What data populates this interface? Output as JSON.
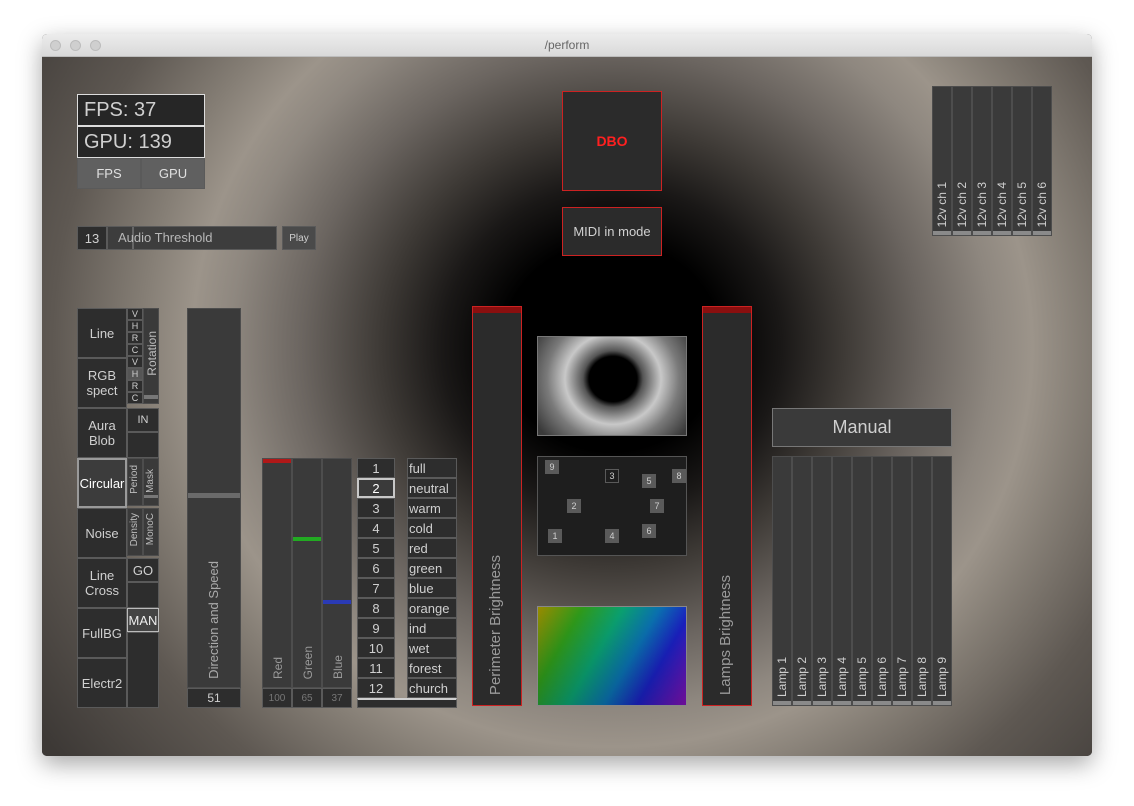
{
  "window": {
    "title": "/perform"
  },
  "stats": {
    "fps_text": "FPS: 37",
    "gpu_text": "GPU: 139",
    "fps_button": "FPS",
    "gpu_button": "GPU"
  },
  "audio": {
    "value": "13",
    "label": "Audio Threshold",
    "play_button": "Play"
  },
  "dbo": {
    "label": "DBO",
    "color": "#ff2020"
  },
  "midi": {
    "label": "MIDI in mode"
  },
  "channels": [
    "12v ch 1",
    "12v ch 2",
    "12v ch 3",
    "12v ch 4",
    "12v ch 5",
    "12v ch 6"
  ],
  "modes": [
    "Line",
    "RGB spect",
    "Aura Blob",
    "Circular",
    "Noise",
    "Line Cross",
    "FullBG",
    "Electr2"
  ],
  "mini_toggles": [
    "V",
    "H",
    "R",
    "C",
    "V",
    "H",
    "R",
    "C"
  ],
  "side_labels": {
    "rotation": "Rotation",
    "in": "IN",
    "period": "Period",
    "mask": "Mask",
    "density": "Density",
    "monoc": "MonoC",
    "go": "GO",
    "man": "MAN"
  },
  "direction": {
    "label": "Direction and Speed",
    "value": "51"
  },
  "rgb": {
    "labels": [
      "Red",
      "Green",
      "Blue"
    ],
    "values": [
      "100",
      "65",
      "37"
    ],
    "levels": [
      100,
      65,
      37
    ],
    "colors": [
      "#b01818",
      "#22aa22",
      "#2a3ab5"
    ]
  },
  "presets": {
    "numbers": [
      "1",
      "2",
      "3",
      "4",
      "5",
      "6",
      "7",
      "8",
      "9",
      "10",
      "11",
      "12"
    ],
    "names": [
      "full",
      "neutral",
      "warm",
      "cold",
      "red",
      "green",
      "blue",
      "orange",
      "ind",
      "wet",
      "forest",
      "church"
    ],
    "selected": 2
  },
  "perimeter": {
    "label": "Perimeter Brightness"
  },
  "lamps_brightness": {
    "label": "Lamps Brightness"
  },
  "lamp_points": [
    "9",
    "3",
    "5",
    "8",
    "2",
    "7",
    "1",
    "4",
    "6"
  ],
  "manual": {
    "label": "Manual"
  },
  "lamps": [
    "Lamp 1",
    "Lamp 2",
    "Lamp 3",
    "Lamp 4",
    "Lamp 5",
    "Lamp 6",
    "Lamp 7",
    "Lamp 8",
    "Lamp 9"
  ]
}
